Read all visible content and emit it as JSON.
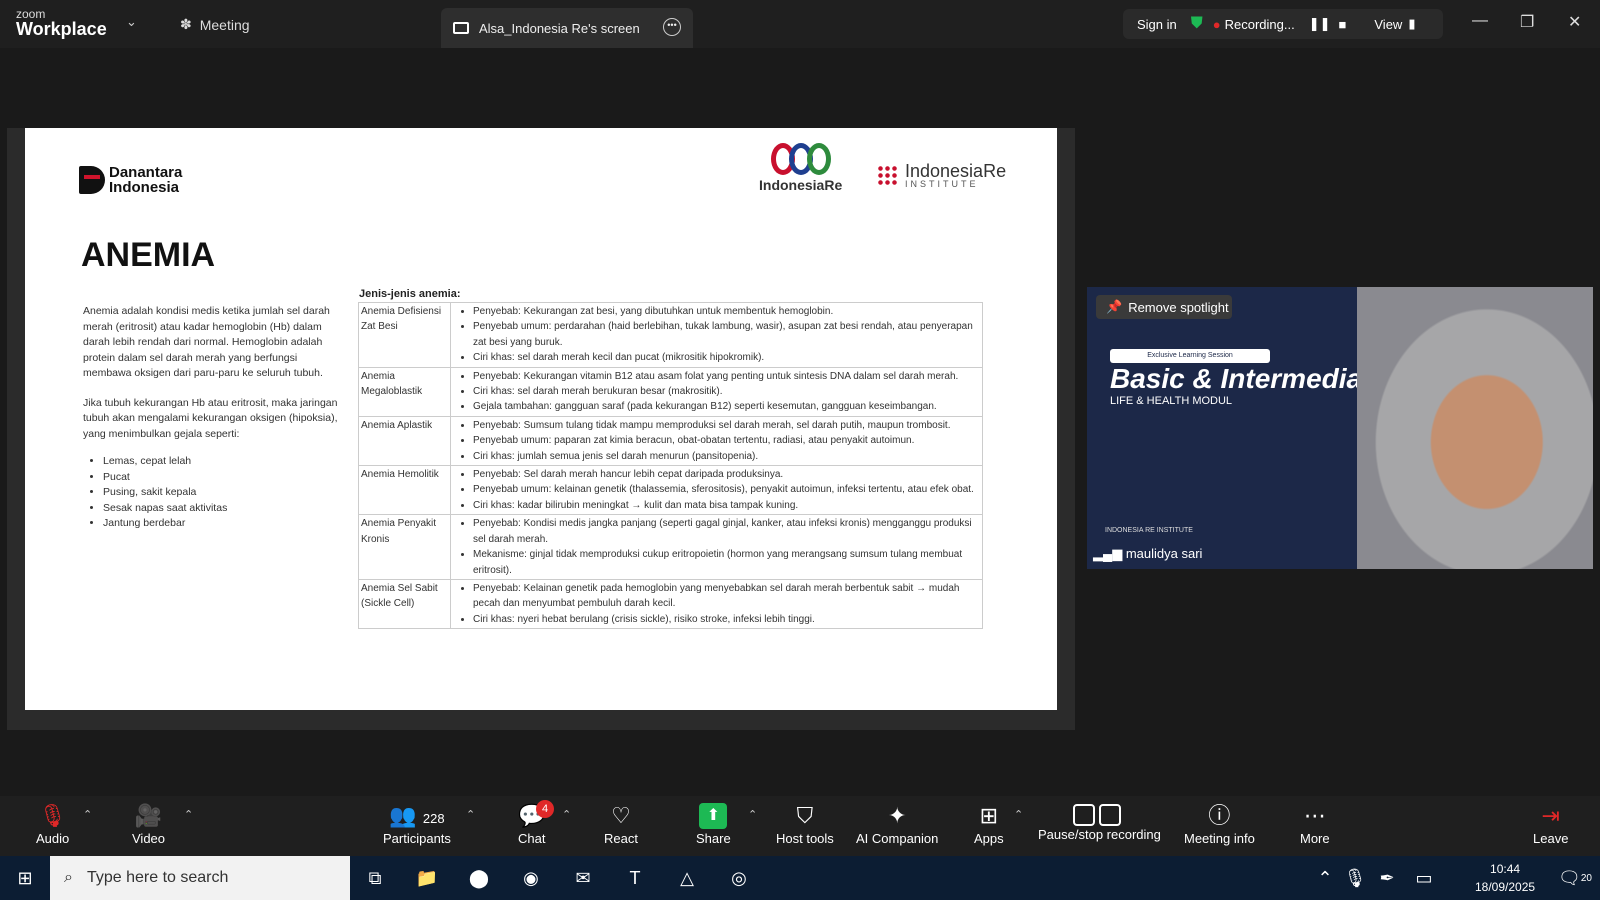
{
  "topbar": {
    "logo_top": "zoom",
    "logo_bottom": "Workplace",
    "meeting_label": "Meeting",
    "share_tab": "Alsa_Indonesia Re's screen",
    "sign_in": "Sign in",
    "recording": "Recording...",
    "view": "View"
  },
  "slide": {
    "brand_left_1": "Danantara",
    "brand_left_2": "Indonesia",
    "brand_mid": "IndonesiaRe",
    "brand_right_1": "IndonesiaRe",
    "brand_right_2": "INSTITUTE",
    "title": "ANEMIA",
    "intro_1": "Anemia adalah kondisi medis ketika jumlah sel darah merah (eritrosit) atau kadar hemoglobin (Hb) dalam darah lebih rendah dari normal. Hemoglobin adalah protein dalam sel darah merah yang berfungsi membawa oksigen dari paru-paru ke seluruh tubuh.",
    "intro_2": "Jika tubuh kekurangan Hb atau eritrosit, maka jaringan tubuh akan mengalami kekurangan oksigen (hipoksia), yang menimbulkan gejala seperti:",
    "symptoms": [
      "Lemas, cepat lelah",
      "Pucat",
      "Pusing, sakit kepala",
      "Sesak napas saat aktivitas",
      "Jantung berdebar"
    ],
    "types_heading": "Jenis-jenis anemia:",
    "types": [
      {
        "name": "Anemia Defisiensi Zat Besi",
        "points": [
          "Penyebab: Kekurangan zat besi, yang dibutuhkan untuk membentuk hemoglobin.",
          "Penyebab umum: perdarahan (haid berlebihan, tukak lambung, wasir), asupan zat besi rendah, atau penyerapan zat besi yang buruk.",
          "Ciri khas: sel darah merah kecil dan pucat (mikrositik hipokromik)."
        ]
      },
      {
        "name": "Anemia Megaloblastik",
        "points": [
          "Penyebab: Kekurangan vitamin B12 atau asam folat yang penting untuk sintesis DNA dalam sel darah merah.",
          "Ciri khas: sel darah merah berukuran besar (makrositik).",
          "Gejala tambahan: gangguan saraf (pada kekurangan B12) seperti kesemutan, gangguan keseimbangan."
        ]
      },
      {
        "name": "Anemia Aplastik",
        "points": [
          "Penyebab: Sumsum tulang tidak mampu memproduksi sel darah merah, sel darah putih, maupun trombosit.",
          "Penyebab umum: paparan zat kimia beracun, obat-obatan tertentu, radiasi, atau penyakit autoimun.",
          "Ciri khas: jumlah semua jenis sel darah menurun (pansitopenia)."
        ]
      },
      {
        "name": "Anemia Hemolitik",
        "points": [
          "Penyebab: Sel darah merah hancur lebih cepat daripada produksinya.",
          "Penyebab umum: kelainan genetik (thalassemia, sferositosis), penyakit autoimun, infeksi tertentu, atau efek obat.",
          "Ciri khas: kadar bilirubin meningkat → kulit dan mata bisa tampak kuning."
        ]
      },
      {
        "name": "Anemia Penyakit Kronis",
        "points": [
          "Penyebab: Kondisi medis jangka panjang (seperti gagal ginjal, kanker, atau infeksi kronis) mengganggu produksi sel darah merah.",
          "Mekanisme: ginjal tidak memproduksi cukup eritropoietin (hormon yang merangsang sumsum tulang membuat eritrosit)."
        ]
      },
      {
        "name": "Anemia Sel Sabit (Sickle Cell)",
        "points": [
          "Penyebab: Kelainan genetik pada hemoglobin yang menyebabkan sel darah merah berbentuk sabit → mudah pecah dan menyumbat pembuluh darah kecil.",
          "Ciri khas: nyeri hebat berulang (crisis sickle), risiko stroke, infeksi lebih tinggi."
        ]
      }
    ]
  },
  "video": {
    "remove_spotlight": "Remove spotlight",
    "session_badge": "Exclusive Learning Session",
    "session_title": "Basic & Intermediate",
    "session_sub": "LIFE & HEALTH MODUL",
    "institute": "INDONESIA RE INSTITUTE",
    "participant": "maulidya sari"
  },
  "toolbar": {
    "audio": "Audio",
    "video": "Video",
    "participants": "Participants",
    "participant_count": "228",
    "chat": "Chat",
    "chat_badge": "4",
    "react": "React",
    "share": "Share",
    "host_tools": "Host tools",
    "ai": "AI Companion",
    "apps": "Apps",
    "pause_rec": "Pause/stop recording",
    "meeting_info": "Meeting info",
    "more": "More",
    "leave": "Leave"
  },
  "taskbar": {
    "search_placeholder": "Type here to search",
    "time": "10:44",
    "date": "18/09/2025",
    "notif": "20"
  },
  "colors": {
    "zoom_blue": "#0b5cff",
    "share_green": "#1db954",
    "leave_red": "#e02828"
  }
}
